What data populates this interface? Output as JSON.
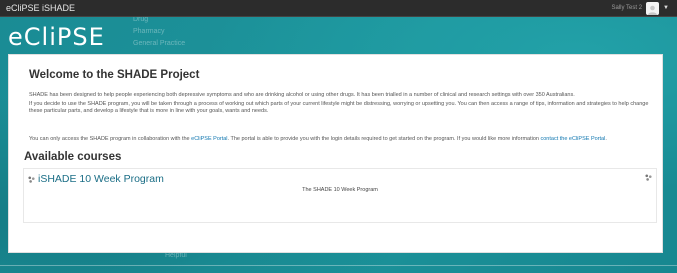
{
  "topbar": {
    "brand": "eCliPSE iSHADE",
    "user_name": "Sally Test 2"
  },
  "background_menu": [
    "Drug",
    "Pharmacy",
    "General Practice"
  ],
  "background_footer_text": "Helpful",
  "logo": {
    "text": "eCliPSE"
  },
  "welcome": {
    "title": "Welcome to the SHADE Project",
    "para1": "SHADE has been designed to help people experiencing both depressive symptoms and who are drinking alcohol or using other drugs. It has been trialled in a number of clinical and research settings with over 350 Australians.",
    "para2": "If you decide to use the SHADE program, you will be taken through a process of working out which parts of your current lifestyle might be distressing, worrying or upsetting you. You can then access a range of tips, information and strategies to help change these particular parts, and develop a lifestyle that is more in line with your goals, wants and needs.",
    "portal_prefix": "You can only access the SHADE program in collaboration with the ",
    "portal_link1": "eCliPSE Portal",
    "portal_middle": ". The portal is able to provide you with the login details required to get started on the program. If you would like more information ",
    "portal_link2": "contact the eCliPSE Portal",
    "portal_suffix": "."
  },
  "courses": {
    "heading": "Available courses",
    "items": [
      {
        "title": "iSHADE 10 Week Program",
        "description": "The SHADE 10 Week Program"
      }
    ]
  },
  "colors": {
    "background": "#1b8e96",
    "topbar": "#2c2c2c",
    "link": "#1177b0",
    "course_title": "#1b6e86"
  }
}
